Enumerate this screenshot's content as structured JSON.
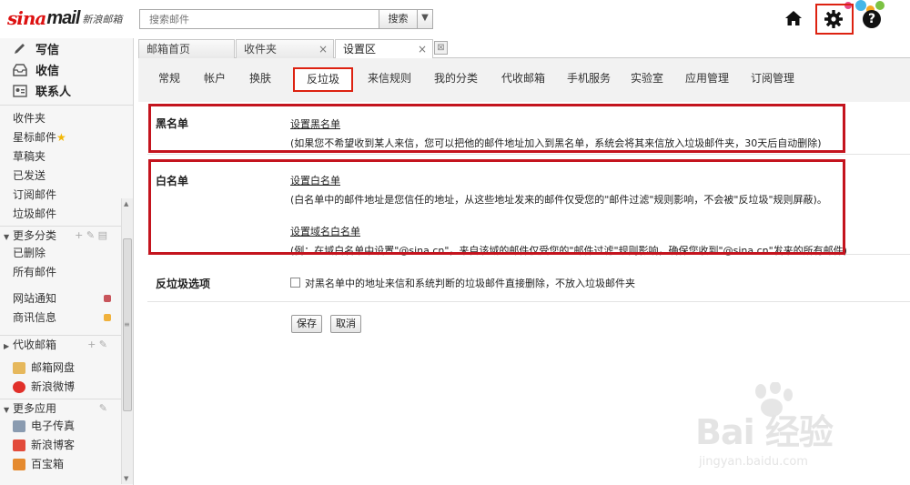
{
  "logo": {
    "brand_sina": "sina",
    "brand_mail": "mail",
    "brand_cn": "新浪邮箱"
  },
  "search": {
    "placeholder": "搜索邮件",
    "button": "搜索"
  },
  "icons": {
    "home": "home-icon",
    "settings": "gear-icon",
    "help": "help-icon",
    "help_glyph": "?"
  },
  "sidebar": {
    "compose": "写信",
    "receive": "收信",
    "contacts": "联系人",
    "folders": [
      "收件夹",
      "星标邮件",
      "草稿夹",
      "已发送",
      "订阅邮件",
      "垃圾邮件"
    ],
    "more_folders": "更多分类",
    "more_folder_items": [
      "已删除",
      "所有邮件"
    ],
    "notice_folders": [
      {
        "label": "网站通知",
        "color": "#c8555b"
      },
      {
        "label": "商讯信息",
        "color": "#f0b13c"
      }
    ],
    "proxy": "代收邮箱",
    "apps_top": [
      "邮箱网盘",
      "新浪微博"
    ],
    "more_apps": "更多应用",
    "apps_bottom": [
      "电子传真",
      "新浪博客",
      "百宝箱"
    ]
  },
  "window_tabs": [
    {
      "label": "邮箱首页"
    },
    {
      "label": "收件夹"
    },
    {
      "label": "设置区"
    }
  ],
  "close_glyph": "×",
  "settings_tabs": [
    "常规",
    "帐户",
    "换肤",
    "反垃圾",
    "来信规则",
    "我的分类",
    "代收邮箱",
    "手机服务",
    "实验室",
    "应用管理",
    "订阅管理"
  ],
  "active_settings_tab": "反垃圾",
  "blacklist": {
    "label": "黑名单",
    "link": "设置黑名单",
    "desc": "(如果您不希望收到某人来信，您可以把他的邮件地址加入到黑名单，系统会将其来信放入垃圾邮件夹，30天后自动删除)"
  },
  "whitelist": {
    "label": "白名单",
    "link": "设置白名单",
    "desc": "(白名单中的邮件地址是您信任的地址，从这些地址发来的邮件仅受您的\"邮件过滤\"规则影响，不会被\"反垃圾\"规则屏蔽)。",
    "domain_link": "设置域名白名单",
    "domain_desc": "(例：在域白名单中设置\"@sina.cn\"，来自该域的邮件仅受您的\"邮件过滤\"规则影响，确保您收到\"@sina.cn\"发来的所有邮件)"
  },
  "options": {
    "label": "反垃圾选项",
    "checkbox_label": "对黑名单中的地址来信和系统判断的垃圾邮件直接删除，不放入垃圾邮件夹",
    "checked": false
  },
  "buttons": {
    "save": "保存",
    "cancel": "取消"
  },
  "watermark": {
    "brand": "Bai 经验",
    "url": "jingyan.baidu.com"
  },
  "colors": {
    "highlight_red": "#c4141e",
    "logo_red": "#dd1111"
  }
}
